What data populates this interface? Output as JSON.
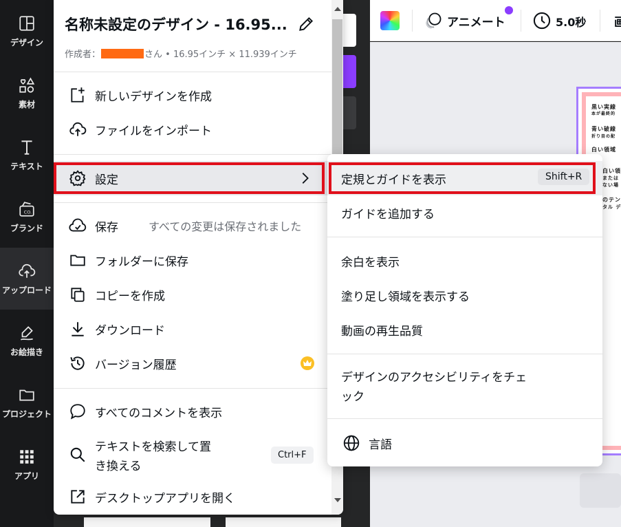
{
  "sidebar": {
    "items": [
      {
        "label": "デザイン",
        "icon": "layout-icon"
      },
      {
        "label": "素材",
        "icon": "shapes-icon"
      },
      {
        "label": "テキスト",
        "icon": "text-icon"
      },
      {
        "label": "ブランド",
        "icon": "brand-icon"
      },
      {
        "label": "アップロード",
        "icon": "cloud-upload-icon"
      },
      {
        "label": "お絵描き",
        "icon": "draw-icon"
      },
      {
        "label": "プロジェクト",
        "icon": "folder-icon"
      },
      {
        "label": "アプリ",
        "icon": "apps-grid-icon"
      }
    ],
    "active_index": 4
  },
  "toolbar": {
    "animate_label": "アニメート",
    "duration_label": "5.0秒",
    "extra_label": "画"
  },
  "menu": {
    "title": "名称未設定のデザイン - 16.95...",
    "author_prefix": "作成者：",
    "author_suffix": "さん • 16.95インチ × 11.939インチ",
    "items": {
      "new_design": "新しいデザインを作成",
      "import_file": "ファイルをインポート",
      "settings": "設定",
      "save": "保存",
      "save_status": "すべての変更は保存されました",
      "save_to_folder": "フォルダーに保存",
      "make_copy": "コピーを作成",
      "download": "ダウンロード",
      "version_history": "バージョン履歴",
      "show_comments": "すべてのコメントを表示",
      "find_replace_line1": "テキストを検索して置",
      "find_replace_line2": "き換える",
      "find_replace_shortcut": "Ctrl+F",
      "open_desktop": "デスクトップアプリを開く"
    }
  },
  "submenu": {
    "show_rulers": "定規とガイドを表示",
    "show_rulers_shortcut": "Shift+R",
    "add_guides": "ガイドを追加する",
    "show_margins": "余白を表示",
    "show_bleed": "塗り足し領域を表示する",
    "video_quality": "動画の再生品質",
    "accessibility_line1": "デザインのアクセシビリティをチェ",
    "accessibility_line2": "ック",
    "language": "言語"
  },
  "canvas": {
    "text_lines": [
      "黒い実線",
      "本が最終的",
      "青い破線",
      "折り目の配",
      "白い領域",
      "白い領域",
      "または",
      "ない場",
      "のテン",
      "タル デ"
    ]
  },
  "colors": {
    "accent": "#8b3dff",
    "annotation_red": "#e0101b",
    "redaction": "#ff6a13",
    "crown": "#fbbf24"
  }
}
